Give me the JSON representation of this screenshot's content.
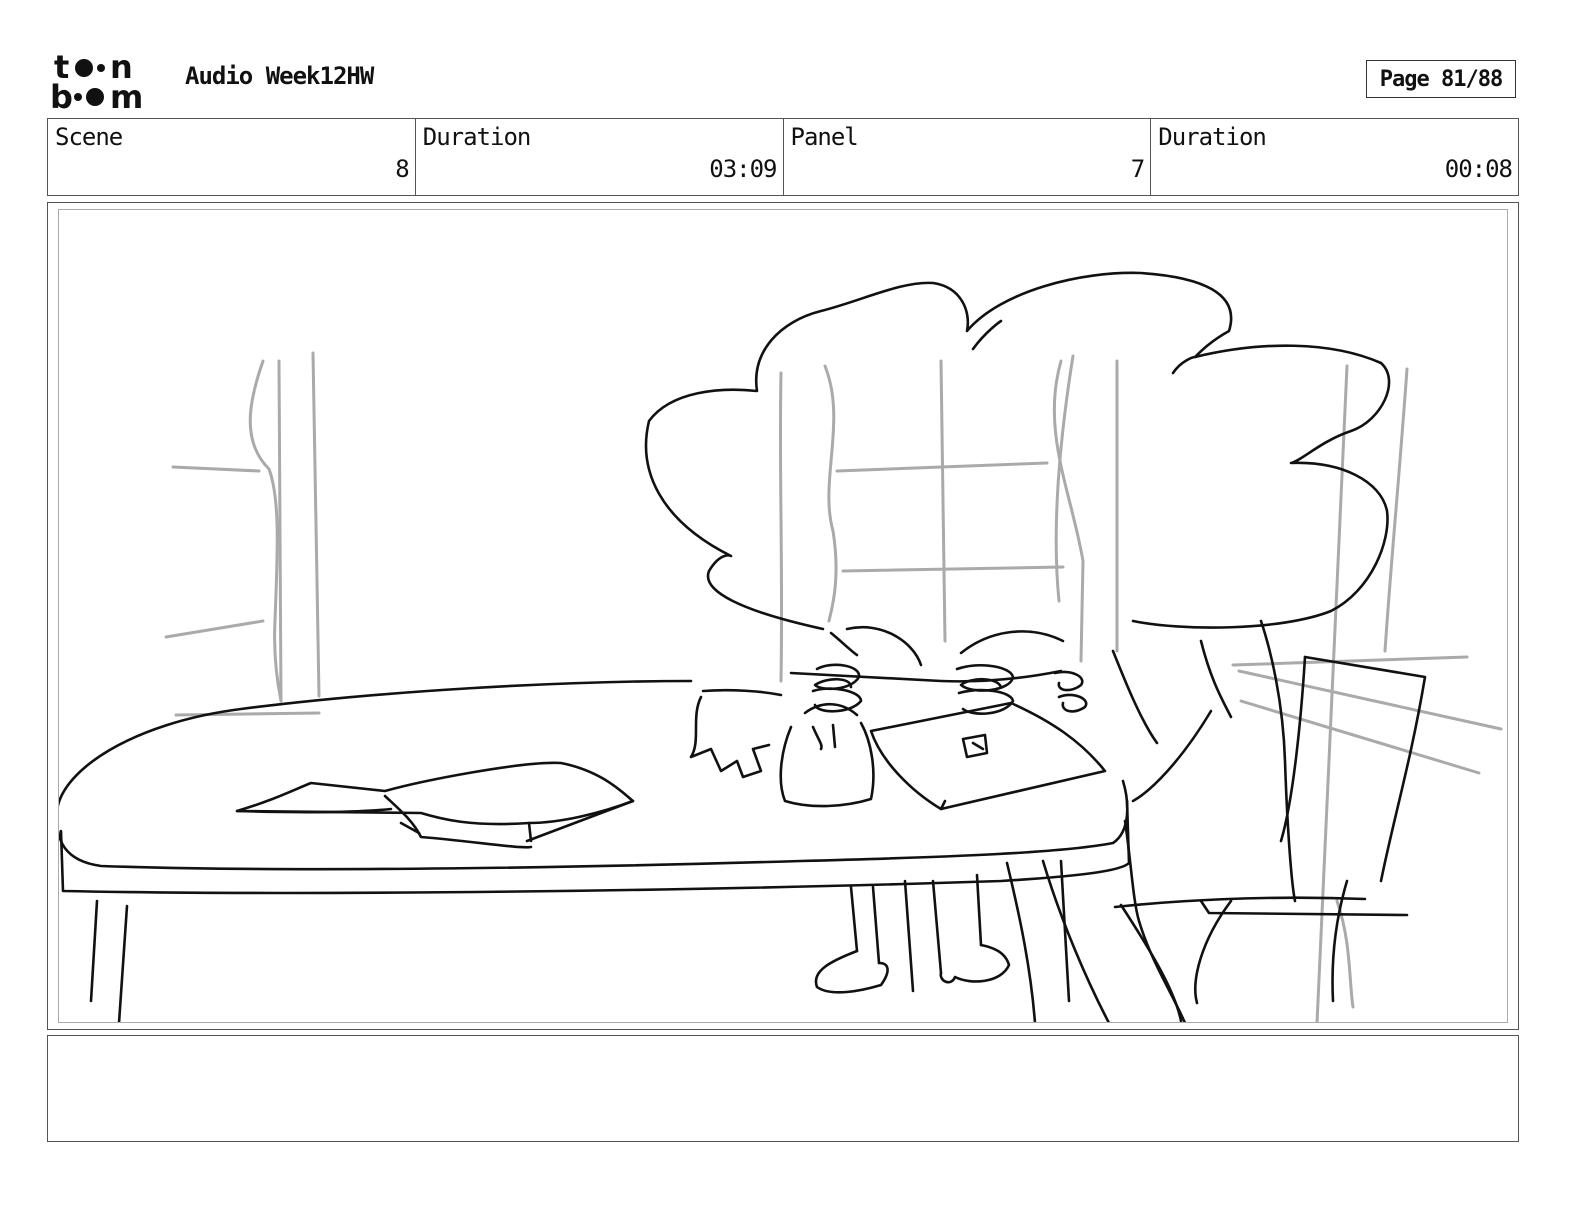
{
  "header": {
    "logo_name": "toon-boom-logo",
    "project_title": "Audio Week12HW",
    "page_label": "Page 81/88"
  },
  "info": {
    "scene_label": "Scene",
    "scene_value": "8",
    "scene_duration_label": "Duration",
    "scene_duration_value": "03:09",
    "panel_label": "Panel",
    "panel_value": "7",
    "panel_duration_label": "Duration",
    "panel_duration_value": "00:08"
  },
  "panel": {
    "sketch_description": ""
  },
  "notes": {
    "text": ""
  }
}
